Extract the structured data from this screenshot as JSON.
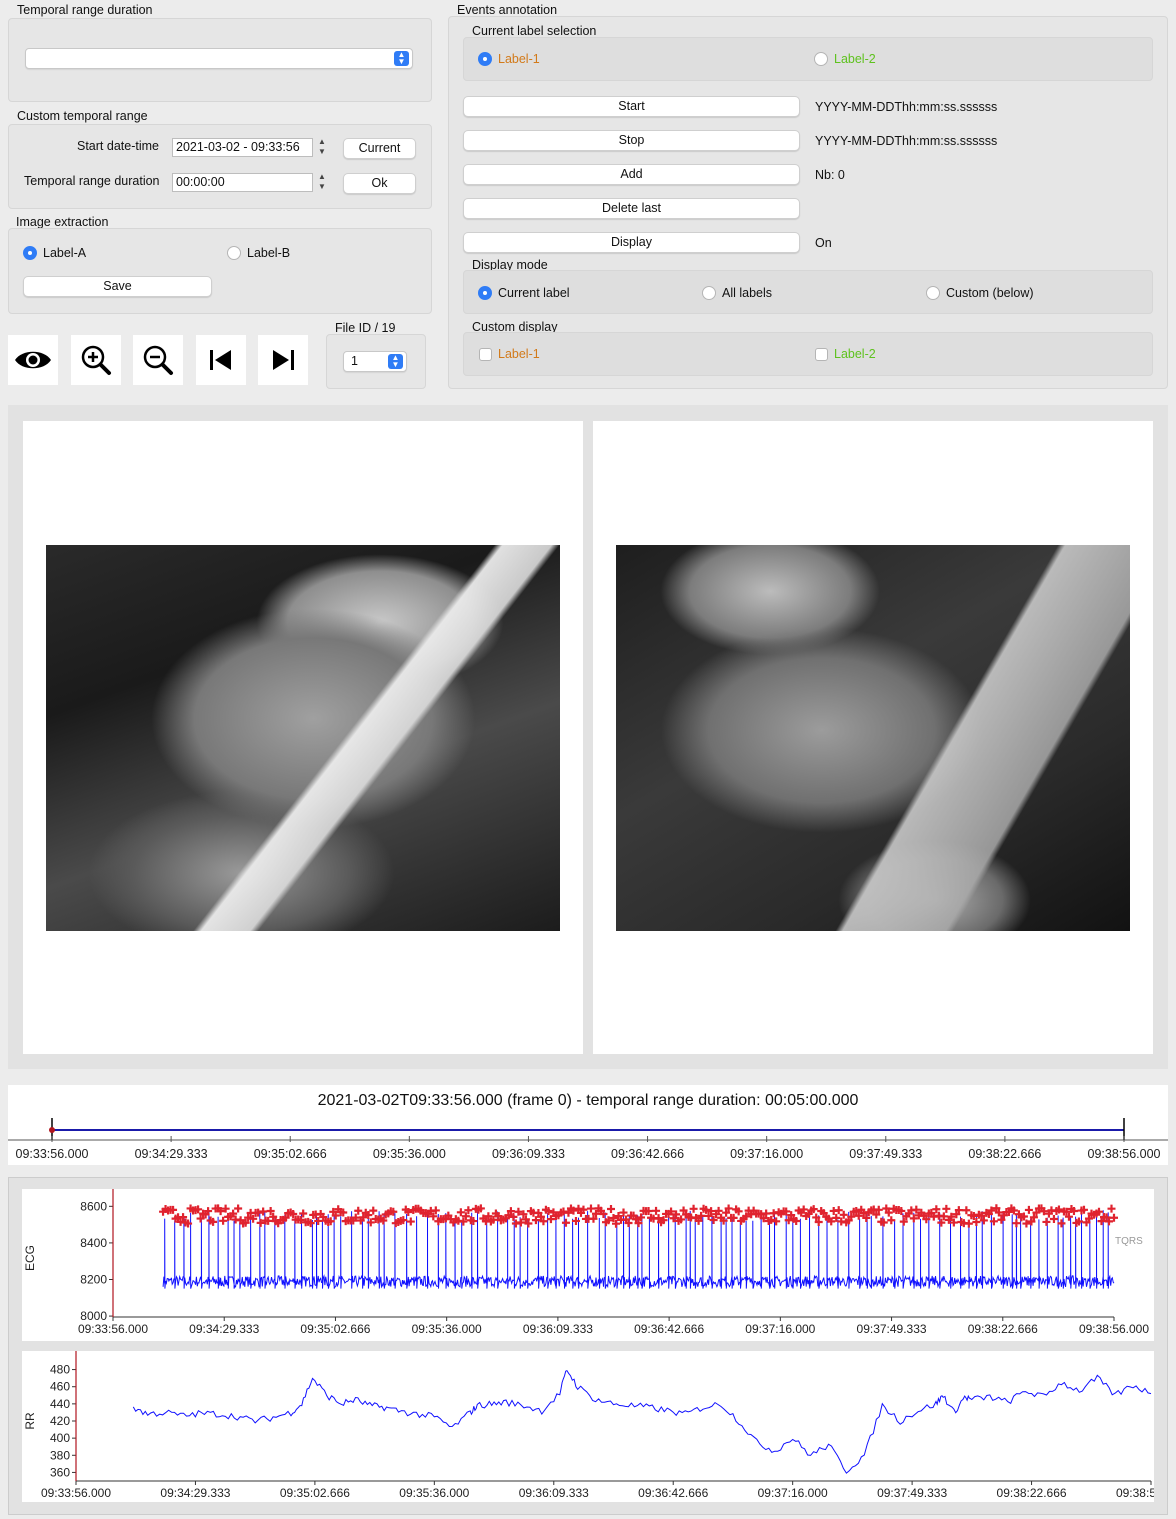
{
  "temporal_range": {
    "title": "Temporal range duration",
    "selected": ""
  },
  "custom_range": {
    "title": "Custom temporal range",
    "start_label": "Start date-time",
    "start_value": "2021-03-02 - 09:33:56",
    "current_button": "Current",
    "duration_label": "Temporal range duration",
    "duration_value": "00:00:00",
    "ok_button": "Ok"
  },
  "image_extraction": {
    "title": "Image extraction",
    "option_a": "Label-A",
    "option_b": "Label-B",
    "selected": "Label-A",
    "save_button": "Save"
  },
  "toolbar": {
    "icons": [
      "eye-icon",
      "zoom-in-icon",
      "zoom-out-icon",
      "skip-to-start-icon",
      "skip-to-end-icon"
    ]
  },
  "file_id": {
    "title": "File ID / 19",
    "value": "1"
  },
  "events": {
    "title": "Events annotation",
    "current_label_title": "Current label selection",
    "label1": "Label-1",
    "label2": "Label-2",
    "label1_color": "#d27a1a",
    "label2_color": "#5ec21e",
    "selected": "Label-1",
    "start_button": "Start",
    "start_value": "YYYY-MM-DDThh:mm:ss.ssssss",
    "stop_button": "Stop",
    "stop_value": "YYYY-MM-DDThh:mm:ss.ssssss",
    "add_button": "Add",
    "count": "Nb: 0",
    "delete_button": "Delete last",
    "display_button": "Display",
    "display_state": "On",
    "display_mode_title": "Display mode",
    "mode_current": "Current label",
    "mode_all": "All labels",
    "mode_custom": "Custom (below)",
    "mode_selected": "Current label",
    "custom_display_title": "Custom display",
    "custom_label1": "Label-1",
    "custom_label2": "Label-2"
  },
  "timeline": {
    "title": "2021-03-02T09:33:56.000 (frame 0) - temporal range duration: 00:05:00.000",
    "ticks": [
      "09:33:56.000",
      "09:34:29.333",
      "09:35:02.666",
      "09:35:36.000",
      "09:36:09.333",
      "09:36:42.666",
      "09:37:16.000",
      "09:37:49.333",
      "09:38:22.666",
      "09:38:56.000"
    ],
    "line_color": "#1a1aaa"
  },
  "chart_data": [
    {
      "type": "line",
      "ylabel": "ECG",
      "yticks": [
        8000,
        8200,
        8400,
        8600
      ],
      "ylim": [
        7995,
        8640
      ],
      "xticks": [
        "09:33:56.000",
        "09:34:29.333",
        "09:35:02.666",
        "09:35:36.000",
        "09:36:09.333",
        "09:36:42.666",
        "09:37:16.000",
        "09:37:49.333",
        "09:38:22.666",
        "09:38:56.000"
      ],
      "xrange_seconds": [
        0,
        300
      ],
      "cursor_seconds": 0,
      "signal_start_seconds": 15,
      "baseline_approx": 8190,
      "rpeak_approx": 8550,
      "series": [
        {
          "name": "",
          "color": "#1010ff",
          "style": "line"
        },
        {
          "name": "",
          "color": "#e0232f",
          "style": "plus-markers"
        }
      ],
      "legend_text": "TQRS"
    },
    {
      "type": "line",
      "ylabel": "RR",
      "yticks": [
        360,
        380,
        400,
        420,
        440,
        460,
        480
      ],
      "ylim": [
        350,
        490
      ],
      "xticks": [
        "09:33:56.000",
        "09:34:29.333",
        "09:35:02.666",
        "09:35:36.000",
        "09:36:09.333",
        "09:36:42.666",
        "09:37:16.000",
        "09:37:49.333",
        "09:38:22.666",
        "09:38:56.000"
      ],
      "xrange_seconds": [
        0,
        300
      ],
      "cursor_seconds": 0,
      "series": [
        {
          "name": "",
          "color": "#1010ff",
          "x": [
            16,
            20,
            25,
            30,
            35,
            40,
            45,
            50,
            55,
            60,
            63,
            66,
            70,
            74,
            78,
            82,
            86,
            90,
            95,
            100,
            105,
            110,
            112,
            116,
            120,
            125,
            130,
            135,
            137,
            140,
            145,
            150,
            155,
            160,
            165,
            170,
            175,
            180,
            185,
            190,
            195,
            200,
            205,
            210,
            215,
            220,
            225,
            230,
            235,
            240,
            242,
            245,
            248,
            250,
            255,
            260,
            265,
            270,
            275,
            280,
            285,
            290,
            295,
            300
          ],
          "y": [
            436,
            428,
            430,
            426,
            429,
            428,
            425,
            420,
            424,
            430,
            440,
            470,
            450,
            440,
            445,
            438,
            436,
            432,
            428,
            425,
            412,
            430,
            438,
            440,
            442,
            438,
            432,
            452,
            480,
            460,
            445,
            440,
            438,
            436,
            432,
            428,
            436,
            440,
            420,
            395,
            385,
            400,
            380,
            392,
            362,
            380,
            438,
            420,
            432,
            440,
            450,
            430,
            448,
            445,
            448,
            442,
            455,
            448,
            465,
            455,
            470,
            450,
            462,
            452
          ]
        }
      ]
    }
  ]
}
